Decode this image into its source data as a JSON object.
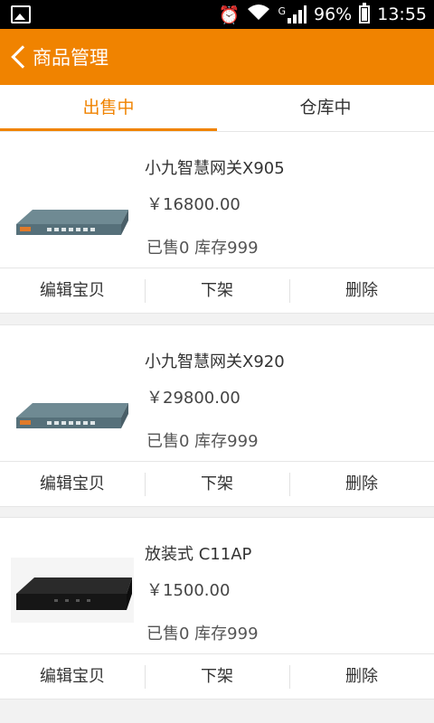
{
  "status_bar": {
    "gallery_icon": "image-icon",
    "alarm_icon": "alarm-icon",
    "wifi_icon": "wifi-icon",
    "network_type": "G",
    "signal_icon": "signal-icon",
    "battery_percent": "96%",
    "time": "13:55"
  },
  "header": {
    "back_icon": "chevron-left-icon",
    "title": "商品管理"
  },
  "tabs": [
    {
      "label": "出售中",
      "active": true
    },
    {
      "label": "仓库中",
      "active": false
    }
  ],
  "accent_color": "#f08300",
  "products": [
    {
      "name": "小九智慧网关X905",
      "price": "￥16800.00",
      "stats": "已售0   库存999",
      "image": "router-device-image",
      "actions": [
        "编辑宝贝",
        "下架",
        "删除"
      ]
    },
    {
      "name": "小九智慧网关X920",
      "price": "￥29800.00",
      "stats": "已售0   库存999",
      "image": "router-device-image",
      "actions": [
        "编辑宝贝",
        "下架",
        "删除"
      ]
    },
    {
      "name": "放装式 C11AP",
      "price": "￥1500.00",
      "stats": "已售0   库存999",
      "image": "access-point-image",
      "actions": [
        "编辑宝贝",
        "下架",
        "删除"
      ]
    }
  ]
}
